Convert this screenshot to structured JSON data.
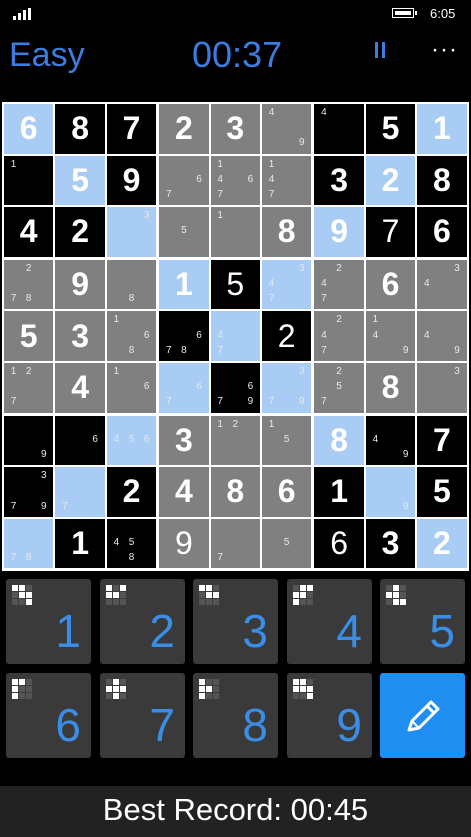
{
  "status": {
    "time": "6:05"
  },
  "header": {
    "difficulty": "Easy",
    "timer": "00:37"
  },
  "colors": {
    "accent": "#3b7de0",
    "highlight": "#a8ccf4",
    "button": "#3a3a3a",
    "pencil": "#1f8ef0"
  },
  "board": {
    "rows": [
      [
        {
          "bg": "blue",
          "v": "6",
          "g": true
        },
        {
          "bg": "black",
          "v": "8",
          "g": true
        },
        {
          "bg": "black",
          "v": "7",
          "g": true
        },
        {
          "bg": "gray",
          "v": "2",
          "g": true
        },
        {
          "bg": "gray",
          "v": "3",
          "g": true
        },
        {
          "bg": "gray",
          "n": [
            "4",
            "",
            "",
            "",
            "",
            "",
            "",
            "",
            "9"
          ]
        },
        {
          "bg": "black",
          "n": [
            "4"
          ]
        },
        {
          "bg": "black",
          "v": "5",
          "g": true
        },
        {
          "bg": "blue",
          "v": "1",
          "g": true
        }
      ],
      [
        {
          "bg": "black",
          "n": [
            "1"
          ]
        },
        {
          "bg": "blue",
          "v": "5",
          "g": true
        },
        {
          "bg": "black",
          "v": "9",
          "g": true
        },
        {
          "bg": "gray",
          "n": [
            "",
            "",
            "",
            "",
            "",
            "6",
            "7"
          ]
        },
        {
          "bg": "gray",
          "n": [
            "1",
            "",
            "",
            "4",
            "",
            "6",
            "7"
          ]
        },
        {
          "bg": "gray",
          "n": [
            "1",
            "",
            "",
            "4",
            "",
            "",
            "7"
          ]
        },
        {
          "bg": "black",
          "v": "3",
          "g": true
        },
        {
          "bg": "blue",
          "v": "2",
          "g": true
        },
        {
          "bg": "black",
          "v": "8",
          "g": true
        }
      ],
      [
        {
          "bg": "black",
          "v": "4",
          "g": true
        },
        {
          "bg": "black",
          "v": "2",
          "g": true
        },
        {
          "bg": "blue",
          "n": [
            "",
            "",
            "3"
          ]
        },
        {
          "bg": "gray",
          "n": [
            "",
            "",
            "",
            "",
            "5"
          ]
        },
        {
          "bg": "gray",
          "n": [
            "1"
          ]
        },
        {
          "bg": "gray",
          "v": "8",
          "g": true
        },
        {
          "bg": "blue",
          "v": "9",
          "g": true
        },
        {
          "bg": "black",
          "v": "7"
        },
        {
          "bg": "black",
          "v": "6",
          "g": true
        }
      ],
      [
        {
          "bg": "gray",
          "n": [
            "",
            "2",
            "",
            "",
            "",
            "",
            "7",
            "8"
          ]
        },
        {
          "bg": "gray",
          "v": "9",
          "g": true
        },
        {
          "bg": "gray",
          "n": [
            "",
            "",
            "",
            "",
            "",
            "",
            "",
            "8"
          ]
        },
        {
          "bg": "blue",
          "v": "1",
          "g": true
        },
        {
          "bg": "black",
          "v": "5"
        },
        {
          "bg": "blue",
          "n": [
            "",
            "",
            "3",
            "4",
            "",
            "",
            "7"
          ]
        },
        {
          "bg": "gray",
          "n": [
            "",
            "2",
            "",
            "4",
            "",
            "",
            "7"
          ]
        },
        {
          "bg": "gray",
          "v": "6",
          "g": true
        },
        {
          "bg": "gray",
          "n": [
            "",
            "",
            "3",
            "4"
          ]
        }
      ],
      [
        {
          "bg": "gray",
          "v": "5",
          "g": true
        },
        {
          "bg": "gray",
          "v": "3",
          "g": true
        },
        {
          "bg": "gray",
          "n": [
            "1",
            "",
            "",
            "",
            "",
            "6",
            "",
            "8"
          ]
        },
        {
          "bg": "black",
          "n": [
            "",
            "",
            "",
            "",
            "",
            "6",
            "7",
            "8"
          ]
        },
        {
          "bg": "blue",
          "n": [
            "",
            "",
            "",
            "4",
            "",
            "",
            "7"
          ]
        },
        {
          "bg": "black",
          "v": "2"
        },
        {
          "bg": "gray",
          "n": [
            "",
            "2",
            "",
            "4",
            "",
            "",
            "7"
          ]
        },
        {
          "bg": "gray",
          "n": [
            "1",
            "",
            "",
            "4",
            "",
            "",
            "",
            "",
            "9"
          ]
        },
        {
          "bg": "gray",
          "n": [
            "",
            "",
            "",
            "4",
            "",
            "",
            "",
            "",
            "9"
          ]
        }
      ],
      [
        {
          "bg": "gray",
          "n": [
            "1",
            "2",
            "",
            "",
            "",
            "",
            "7"
          ]
        },
        {
          "bg": "gray",
          "v": "4",
          "g": true
        },
        {
          "bg": "gray",
          "n": [
            "1",
            "",
            "",
            "",
            "",
            "6"
          ]
        },
        {
          "bg": "blue",
          "n": [
            "",
            "",
            "",
            "",
            "",
            "6",
            "7"
          ]
        },
        {
          "bg": "black",
          "n": [
            "",
            "",
            "",
            "",
            "",
            "6",
            "7",
            "",
            "9"
          ]
        },
        {
          "bg": "blue",
          "n": [
            "",
            "",
            "3",
            "",
            "",
            "",
            "7",
            "",
            "9"
          ]
        },
        {
          "bg": "gray",
          "n": [
            "",
            "2",
            "",
            "",
            "5",
            "",
            "7"
          ]
        },
        {
          "bg": "gray",
          "v": "8",
          "g": true
        },
        {
          "bg": "gray",
          "n": [
            "",
            "",
            "3"
          ]
        }
      ],
      [
        {
          "bg": "black",
          "n": [
            "",
            "",
            "",
            "",
            "",
            "",
            "",
            "",
            "9"
          ]
        },
        {
          "bg": "black",
          "n": [
            "",
            "",
            "",
            "",
            "",
            "6"
          ]
        },
        {
          "bg": "blue",
          "n": [
            "",
            "",
            "",
            "4",
            "5",
            "6"
          ]
        },
        {
          "bg": "gray",
          "v": "3",
          "g": true
        },
        {
          "bg": "gray",
          "n": [
            "1",
            "2"
          ]
        },
        {
          "bg": "gray",
          "n": [
            "1",
            "",
            "",
            "",
            "5"
          ]
        },
        {
          "bg": "blue",
          "v": "8",
          "g": true
        },
        {
          "bg": "black",
          "n": [
            "",
            "",
            "",
            "4",
            "",
            "",
            "",
            "",
            "9"
          ]
        },
        {
          "bg": "black",
          "v": "7",
          "g": true
        }
      ],
      [
        {
          "bg": "black",
          "n": [
            "",
            "",
            "3",
            "",
            "",
            "",
            "7",
            "",
            "9"
          ]
        },
        {
          "bg": "blue",
          "n": [
            "",
            "",
            "",
            "",
            "",
            "",
            "7"
          ]
        },
        {
          "bg": "black",
          "v": "2",
          "g": true
        },
        {
          "bg": "gray",
          "v": "4",
          "g": true
        },
        {
          "bg": "gray",
          "v": "8",
          "g": true
        },
        {
          "bg": "gray",
          "v": "6",
          "g": true
        },
        {
          "bg": "black",
          "v": "1",
          "g": true
        },
        {
          "bg": "blue",
          "n": [
            "",
            "",
            "",
            "",
            "",
            "",
            "",
            "",
            "9"
          ]
        },
        {
          "bg": "black",
          "v": "5",
          "g": true
        }
      ],
      [
        {
          "bg": "blue",
          "n": [
            "",
            "",
            "",
            "",
            "",
            "",
            "7",
            "8"
          ]
        },
        {
          "bg": "black",
          "v": "1",
          "g": true
        },
        {
          "bg": "black",
          "n": [
            "",
            "",
            "",
            "4",
            "5",
            "",
            "",
            "8"
          ]
        },
        {
          "bg": "gray",
          "v": "9"
        },
        {
          "bg": "gray",
          "n": [
            "",
            "",
            "",
            "",
            "",
            "",
            "7"
          ]
        },
        {
          "bg": "gray",
          "n": [
            "",
            "",
            "",
            "",
            "5"
          ]
        },
        {
          "bg": "black",
          "v": "6"
        },
        {
          "bg": "black",
          "v": "3",
          "g": true
        },
        {
          "bg": "blue",
          "v": "2",
          "g": true
        }
      ]
    ]
  },
  "numpad": {
    "keys": [
      {
        "label": "1",
        "pattern": [
          1,
          1,
          0,
          0,
          1,
          1,
          0,
          0,
          1
        ]
      },
      {
        "label": "2",
        "pattern": [
          1,
          0,
          1,
          1,
          1,
          0,
          0,
          0,
          0
        ]
      },
      {
        "label": "3",
        "pattern": [
          1,
          1,
          0,
          0,
          1,
          1,
          0,
          0,
          0
        ]
      },
      {
        "label": "4",
        "pattern": [
          0,
          1,
          1,
          1,
          1,
          0,
          1,
          0,
          0
        ]
      },
      {
        "label": "5",
        "pattern": [
          0,
          1,
          0,
          1,
          1,
          0,
          0,
          1,
          1
        ]
      },
      {
        "label": "6",
        "pattern": [
          1,
          1,
          0,
          1,
          0,
          0,
          1,
          0,
          0
        ]
      },
      {
        "label": "7",
        "pattern": [
          0,
          1,
          0,
          1,
          1,
          1,
          0,
          1,
          0
        ]
      },
      {
        "label": "8",
        "pattern": [
          1,
          0,
          0,
          1,
          1,
          0,
          1,
          0,
          0
        ]
      },
      {
        "label": "9",
        "pattern": [
          1,
          1,
          0,
          1,
          1,
          1,
          0,
          0,
          1
        ]
      }
    ],
    "pencil_icon": "pencil-icon"
  },
  "footer": {
    "record": "Best Record: 00:45"
  }
}
